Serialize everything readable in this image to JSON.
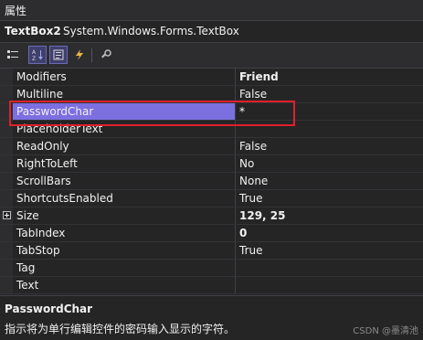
{
  "panel_title": "属性",
  "object": {
    "name": "TextBox2",
    "type": "System.Windows.Forms.TextBox"
  },
  "toolbar": {
    "categorized_icon": "categorized-icon",
    "alphabetical_icon": "alphabetical-icon",
    "properties_icon": "properties-icon",
    "events_icon": "events-icon",
    "property_pages_icon": "property-pages-icon"
  },
  "properties": [
    {
      "name": "Modifiers",
      "value": "Friend"
    },
    {
      "name": "Multiline",
      "value": "False"
    },
    {
      "name": "PasswordChar",
      "value": "*"
    },
    {
      "name": "PlaceholderText",
      "value": ""
    },
    {
      "name": "ReadOnly",
      "value": "False"
    },
    {
      "name": "RightToLeft",
      "value": "No"
    },
    {
      "name": "ScrollBars",
      "value": "None"
    },
    {
      "name": "ShortcutsEnabled",
      "value": "True"
    },
    {
      "name": "Size",
      "value": "129, 25"
    },
    {
      "name": "TabIndex",
      "value": "0"
    },
    {
      "name": "TabStop",
      "value": "True"
    },
    {
      "name": "Tag",
      "value": ""
    },
    {
      "name": "Text",
      "value": ""
    }
  ],
  "selected_property": "PasswordChar",
  "description": {
    "title": "PasswordChar",
    "text": "指示将为单行编辑控件的密码输入显示的字符。"
  },
  "watermark": "CSDN @墨清池",
  "colors": {
    "selection": "#7c6fe0",
    "highlight_box": "#e0202a",
    "background": "#252526"
  }
}
